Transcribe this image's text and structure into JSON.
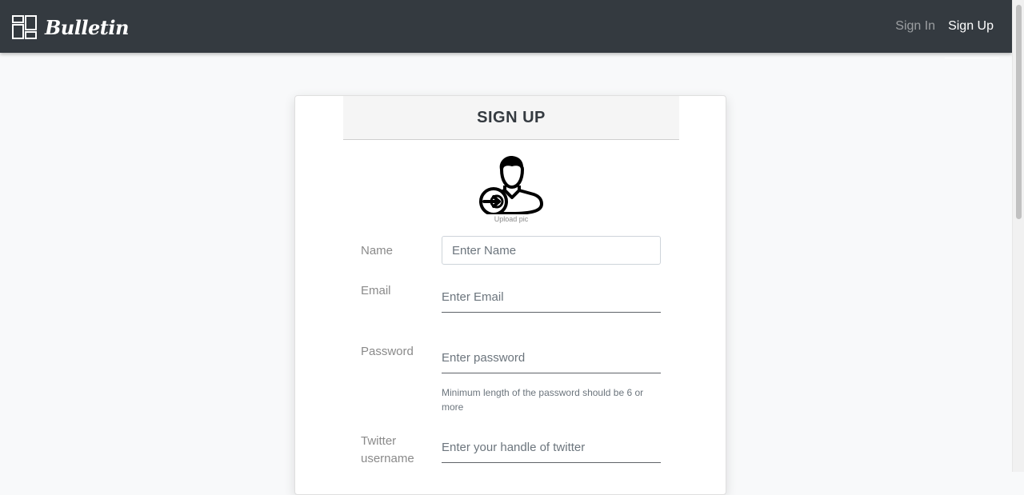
{
  "navbar": {
    "brand": "Bulletin",
    "links": [
      {
        "label": "Sign In"
      },
      {
        "label": "Sign Up"
      }
    ]
  },
  "form": {
    "title": "SIGN UP",
    "upload_caption": "Upload pic",
    "fields": {
      "name": {
        "label": "Name",
        "placeholder": "Enter Name",
        "value": ""
      },
      "email": {
        "label": "Email",
        "placeholder": "Enter Email",
        "value": ""
      },
      "password": {
        "label": "Password",
        "placeholder": "Enter password",
        "value": "",
        "hint": "Minimum length of the password should be 6 or more"
      },
      "twitter": {
        "label": "Twitter username",
        "placeholder": "Enter your handle of twitter",
        "value": ""
      }
    }
  },
  "icons": {
    "brand": "dashboard-grid-icon",
    "avatar": "user-upload-icon"
  },
  "colors": {
    "navbar_bg": "#343a40",
    "page_bg": "#f8f9fa",
    "card_bg": "#ffffff",
    "header_bg": "#f5f5f5"
  }
}
